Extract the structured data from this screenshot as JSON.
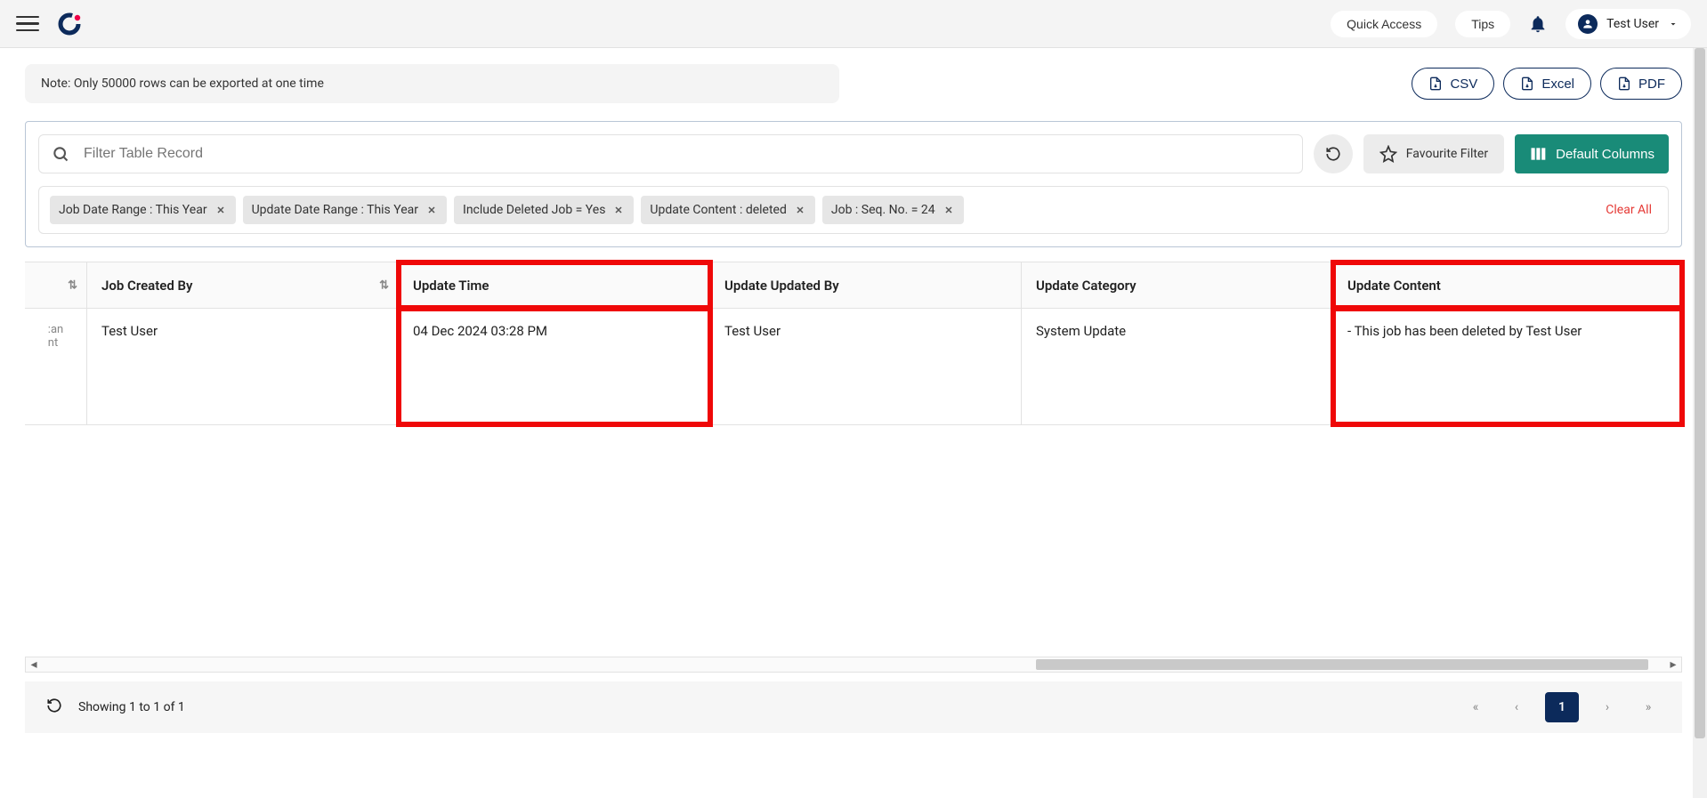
{
  "header": {
    "quick_access": "Quick Access",
    "tips": "Tips",
    "user_name": "Test User"
  },
  "export": {
    "note": "Note: Only 50000 rows can be exported at one time",
    "csv": "CSV",
    "excel": "Excel",
    "pdf": "PDF"
  },
  "toolbar": {
    "search_placeholder": "Filter Table Record",
    "favourite_filter": "Favourite Filter",
    "default_columns": "Default Columns"
  },
  "filters": {
    "items": [
      {
        "label": "Job Date Range  :  This Year"
      },
      {
        "label": "Update Date Range  :  This Year"
      },
      {
        "label": "Include Deleted Job  =  Yes"
      },
      {
        "label": "Update Content  :  deleted"
      },
      {
        "label": "Job : Seq. No.  =  24"
      }
    ],
    "clear_all": "Clear All"
  },
  "table": {
    "columns": {
      "c0_fragment": ":an\nnt",
      "c1": "Job Created By",
      "c2": "Update Time",
      "c3": "Update Updated By",
      "c4": "Update Category",
      "c5": "Update Content"
    },
    "rows": [
      {
        "c1": "Test User",
        "c2": "04 Dec 2024 03:28 PM",
        "c3": "Test User",
        "c4": "System Update",
        "c5": "- This job has been deleted by Test User"
      }
    ]
  },
  "pagination": {
    "summary": "Showing 1 to 1 of 1",
    "current": "1"
  }
}
